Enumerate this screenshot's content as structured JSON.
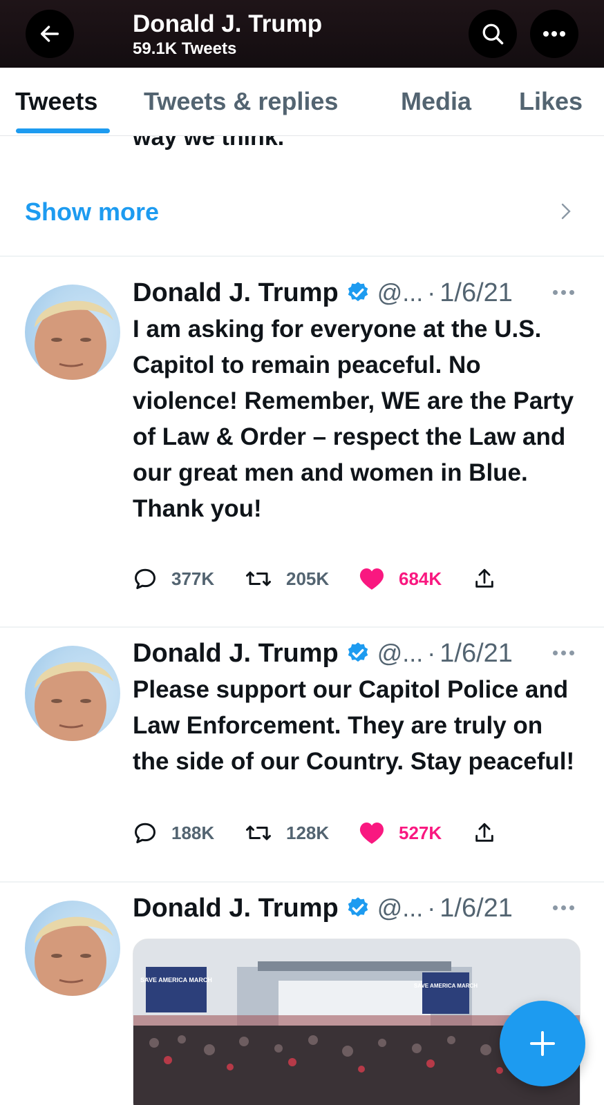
{
  "header": {
    "title": "Donald J. Trump",
    "subtitle": "59.1K Tweets"
  },
  "tabs": [
    {
      "label": "Tweets",
      "active": true
    },
    {
      "label": "Tweets & replies",
      "active": false
    },
    {
      "label": "Media",
      "active": false
    },
    {
      "label": "Likes",
      "active": false
    }
  ],
  "partial_text": "way we think.",
  "show_more": "Show more",
  "tweets": [
    {
      "name": "Donald J. Trump",
      "handle": "@...",
      "separator": "·",
      "date": "1/6/21",
      "text": "I am asking for everyone at the U.S. Capitol to remain peaceful. No violence! Remember, WE are the Party of Law & Order – respect the Law and our great men and women in Blue. Thank you!",
      "replies": "377K",
      "retweets": "205K",
      "likes": "684K"
    },
    {
      "name": "Donald J. Trump",
      "handle": "@...",
      "separator": "·",
      "date": "1/6/21",
      "text": "Please support our Capitol Police and Law Enforcement. They are truly on the side of our Country. Stay peaceful!",
      "replies": "188K",
      "retweets": "128K",
      "likes": "527K"
    },
    {
      "name": "Donald J. Trump",
      "handle": "@...",
      "separator": "·",
      "date": "1/6/21",
      "media_signs": [
        "SAVE AMERICA MARCH",
        "SAVE AMERICA MARCH"
      ]
    }
  ],
  "colors": {
    "accent": "#1d9bf0",
    "like": "#f91880",
    "muted": "#536471"
  }
}
